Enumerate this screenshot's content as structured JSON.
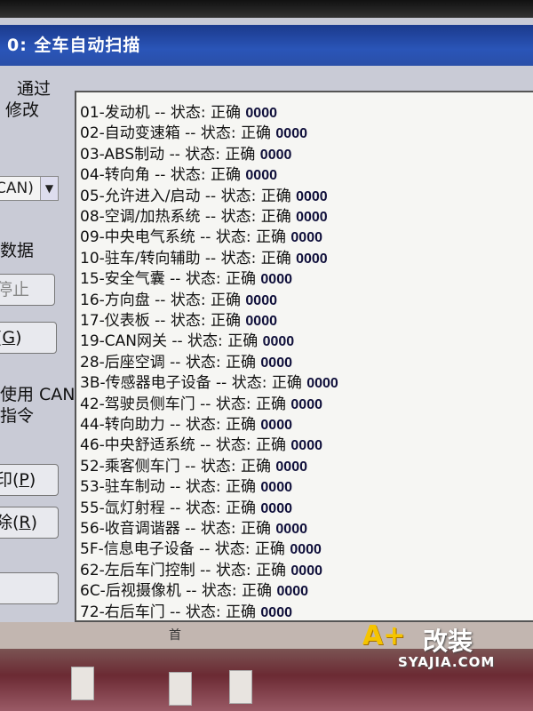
{
  "window": {
    "title": "0:   全车自动扫描"
  },
  "side": {
    "text1_line1": "　通过",
    "text1_line2": "修改",
    "select_value": "CAN)",
    "text2": "数据",
    "btn_stop": "停止",
    "btn_g_prefix": "(",
    "btn_g_key": "G",
    "btn_g_suffix": ")",
    "text3_line1": "使用 CAN",
    "text3_line2": "指令",
    "btn_print_label": "印(",
    "btn_print_key": "P",
    "btn_print_suffix": ")",
    "btn_delete_label": "除(",
    "btn_delete_key": "R",
    "btn_delete_suffix": ")"
  },
  "scan_results": [
    {
      "text": "01-发动机 -- 状态: 正确 ",
      "code": "0000"
    },
    {
      "text": "02-自动变速箱 -- 状态: 正确 ",
      "code": "0000"
    },
    {
      "text": "03-ABS制动 -- 状态: 正确 ",
      "code": "0000"
    },
    {
      "text": "04-转向角 -- 状态: 正确 ",
      "code": "0000"
    },
    {
      "text": "05-允许进入/启动 -- 状态: 正确 ",
      "code": "0000"
    },
    {
      "text": "08-空调/加热系统 -- 状态: 正确 ",
      "code": "0000"
    },
    {
      "text": "09-中央电气系统 -- 状态: 正确 ",
      "code": "0000"
    },
    {
      "text": "10-驻车/转向辅助 -- 状态: 正确 ",
      "code": "0000"
    },
    {
      "text": "15-安全气囊 -- 状态: 正确 ",
      "code": "0000"
    },
    {
      "text": "16-方向盘 -- 状态: 正确 ",
      "code": "0000"
    },
    {
      "text": "17-仪表板 -- 状态: 正确 ",
      "code": "0000"
    },
    {
      "text": "19-CAN网关 -- 状态: 正确 ",
      "code": "0000"
    },
    {
      "text": "28-后座空调 -- 状态: 正确 ",
      "code": "0000"
    },
    {
      "text": "3B-传感器电子设备 -- 状态: 正确 ",
      "code": "0000"
    },
    {
      "text": "42-驾驶员侧车门 -- 状态: 正确 ",
      "code": "0000"
    },
    {
      "text": "44-转向助力 -- 状态: 正确 ",
      "code": "0000"
    },
    {
      "text": "46-中央舒适系统 -- 状态: 正确 ",
      "code": "0000"
    },
    {
      "text": "52-乘客侧车门 -- 状态: 正确 ",
      "code": "0000"
    },
    {
      "text": "53-驻车制动 -- 状态: 正确 ",
      "code": "0000"
    },
    {
      "text": "55-氙灯射程 -- 状态: 正确 ",
      "code": "0000"
    },
    {
      "text": "56-收音调谐器 -- 状态: 正确 ",
      "code": "0000"
    },
    {
      "text": "5F-信息电子设备 -- 状态: 正确 ",
      "code": "0000"
    },
    {
      "text": "62-左后车门控制 -- 状态: 正确 ",
      "code": "0000"
    },
    {
      "text": "6C-后视摄像机 -- 状态: 正确 ",
      "code": "0000"
    },
    {
      "text": "72-右后车门 -- 状态: 正确 ",
      "code": "0000"
    }
  ],
  "taskbar_char": "首",
  "watermark": {
    "logo": "A+",
    "cn": "改装",
    "url": "SYAJIA.COM"
  },
  "colors": {
    "titlebar": "#2a55b8",
    "window_bg": "#c9cbd6",
    "list_bg": "#f6f6f3",
    "watermark_yellow": "#f5c400"
  }
}
